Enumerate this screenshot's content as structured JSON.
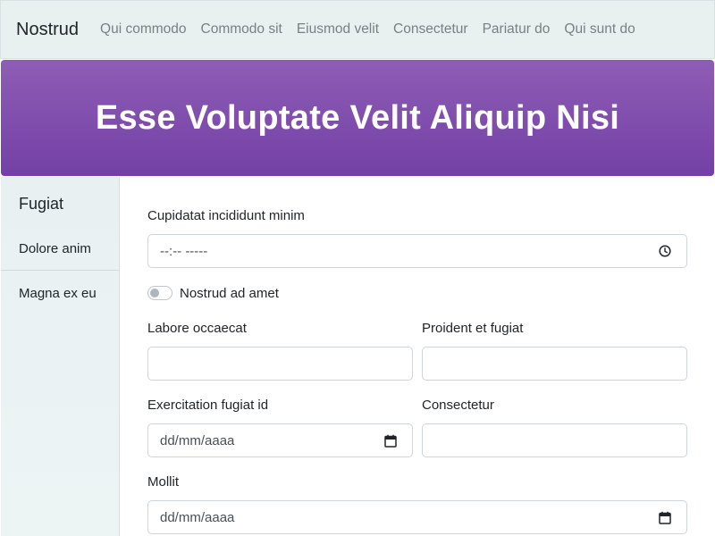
{
  "navbar": {
    "brand": "Nostrud",
    "links": [
      "Qui commodo",
      "Commodo sit",
      "Eiusmod velit",
      "Consectetur",
      "Pariatur do",
      "Qui sunt do"
    ]
  },
  "hero": {
    "title": "Esse Voluptate Velit Aliquip Nisi"
  },
  "sidebar": {
    "heading": "Fugiat",
    "items": [
      "Dolore anim",
      "Magna ex eu"
    ]
  },
  "form": {
    "time_field": {
      "label": "Cupidatat incididunt minim",
      "value": "--:-- -----",
      "icon": "clock-icon"
    },
    "switch": {
      "label": "Nostrud ad amet",
      "checked": false
    },
    "text_field_1": {
      "label": "Labore occaecat",
      "value": ""
    },
    "text_field_2": {
      "label": "Proident et fugiat",
      "value": ""
    },
    "date_field_1": {
      "label": "Exercitation fugiat id",
      "value": "dd/mm/aaaa",
      "icon": "calendar-icon"
    },
    "text_field_3": {
      "label": "Consectetur",
      "value": ""
    },
    "date_field_2": {
      "label": "Mollit",
      "value": "dd/mm/aaaa",
      "icon": "calendar-icon"
    }
  },
  "colors": {
    "hero_top": "#8e5db5",
    "hero_bottom": "#7340a5",
    "navbar_bg": "#e8f0f0",
    "sidebar_bg": "#e8f0f2"
  }
}
